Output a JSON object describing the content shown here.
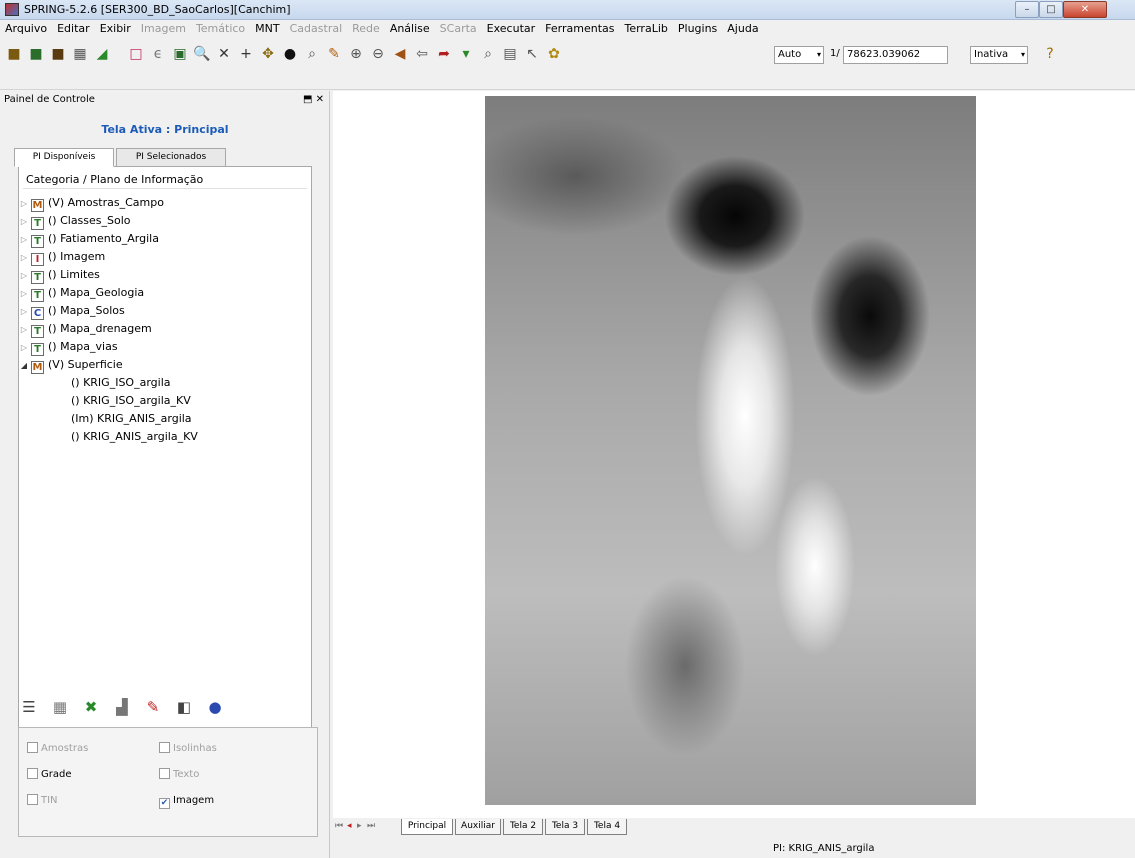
{
  "window": {
    "title": "SPRING-5.2.6 [SER300_BD_SaoCarlos][Canchim]",
    "minimize": "–",
    "maximize": "□",
    "close": "✕"
  },
  "menu": [
    {
      "label": "Arquivo",
      "enabled": true
    },
    {
      "label": "Editar",
      "enabled": true
    },
    {
      "label": "Exibir",
      "enabled": true
    },
    {
      "label": "Imagem",
      "enabled": false
    },
    {
      "label": "Temático",
      "enabled": false
    },
    {
      "label": "MNT",
      "enabled": true
    },
    {
      "label": "Cadastral",
      "enabled": false
    },
    {
      "label": "Rede",
      "enabled": false
    },
    {
      "label": "Análise",
      "enabled": true
    },
    {
      "label": "SCarta",
      "enabled": false
    },
    {
      "label": "Executar",
      "enabled": true
    },
    {
      "label": "Ferramentas",
      "enabled": true
    },
    {
      "label": "TerraLib",
      "enabled": true
    },
    {
      "label": "Plugins",
      "enabled": true
    },
    {
      "label": "Ajuda",
      "enabled": true
    }
  ],
  "toolbar": {
    "zoom_mode": "Auto",
    "scale_prefix": "1/",
    "scale_value": "78623.039062",
    "state": "Inativa"
  },
  "panel": {
    "title": "Painel de Controle",
    "float_icon": "⬒",
    "close_icon": "✕",
    "active_screen": "Tela Ativa : Principal",
    "tabs": [
      "PI Disponíveis",
      "PI Selecionados"
    ],
    "tree_header": "Categoria / Plano de Informação",
    "categories": [
      {
        "icon": "M",
        "label": "(V) Amostras_Campo",
        "expanded": false
      },
      {
        "icon": "T",
        "label": "() Classes_Solo",
        "expanded": false
      },
      {
        "icon": "T",
        "label": "() Fatiamento_Argila",
        "expanded": false
      },
      {
        "icon": "I",
        "label": "() Imagem",
        "expanded": false
      },
      {
        "icon": "T",
        "label": "() Limites",
        "expanded": false
      },
      {
        "icon": "T",
        "label": "() Mapa_Geologia",
        "expanded": false
      },
      {
        "icon": "C",
        "label": "() Mapa_Solos",
        "expanded": false
      },
      {
        "icon": "T",
        "label": "() Mapa_drenagem",
        "expanded": false
      },
      {
        "icon": "T",
        "label": "() Mapa_vias",
        "expanded": false
      },
      {
        "icon": "M",
        "label": "(V) Superficie",
        "expanded": true
      }
    ],
    "plans": [
      {
        "label": "() KRIG_ISO_argila",
        "selected": false
      },
      {
        "label": "() KRIG_ISO_argila_KV",
        "selected": false
      },
      {
        "label": "(Im) KRIG_ANIS_argila",
        "selected": true
      },
      {
        "label": "() KRIG_ANIS_argila_KV",
        "selected": false
      }
    ],
    "visual": [
      {
        "label": "Amostras",
        "checked": false,
        "enabled": false
      },
      {
        "label": "Isolinhas",
        "checked": false,
        "enabled": false
      },
      {
        "label": "Grade",
        "checked": false,
        "enabled": true
      },
      {
        "label": "Texto",
        "checked": false,
        "enabled": false
      },
      {
        "label": "TIN",
        "checked": false,
        "enabled": false
      },
      {
        "label": "Imagem",
        "checked": true,
        "enabled": true
      }
    ]
  },
  "screens": [
    "Principal",
    "Auxiliar",
    "Tela 2",
    "Tela 3",
    "Tela 4"
  ],
  "status": {
    "pi": "PI: KRIG_ANIS_argila"
  },
  "colors": {
    "active_screen": "#1c5bb8",
    "disabled_text": "#9a9a9a"
  }
}
